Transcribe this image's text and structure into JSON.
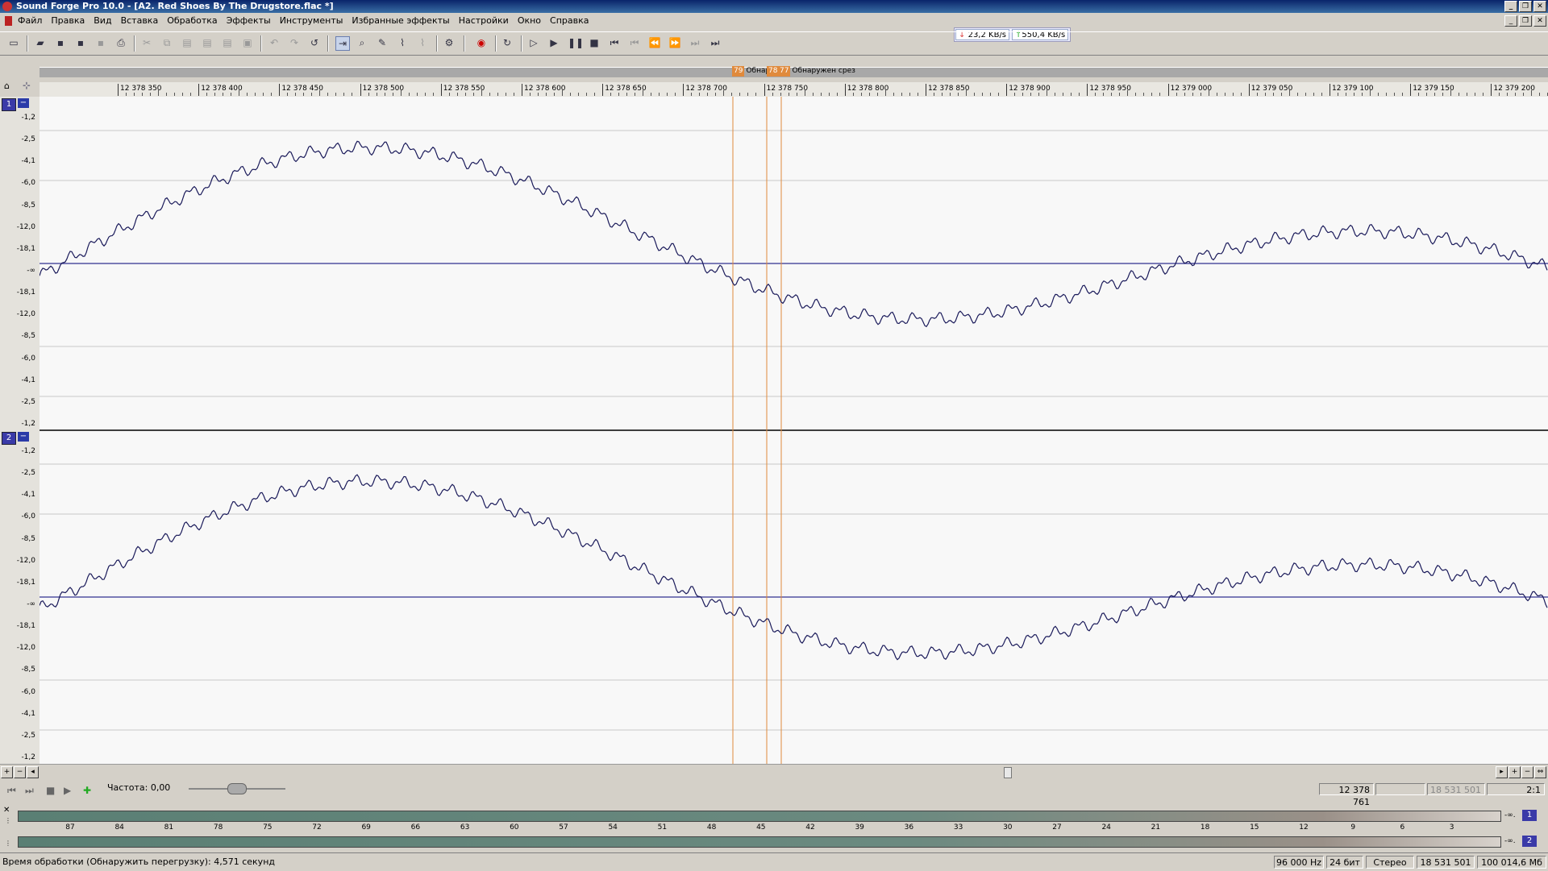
{
  "window": {
    "title": "Sound Forge Pro 10.0 - [A2. Red Shoes By The Drugstore.flac *]"
  },
  "menu": [
    "Файл",
    "Правка",
    "Вид",
    "Вставка",
    "Обработка",
    "Эффекты",
    "Инструменты",
    "Избранные эффекты",
    "Настройки",
    "Окно",
    "Справка"
  ],
  "network": {
    "download": "23,2 KB/s",
    "upload": "550,4 KB/s"
  },
  "markers": [
    {
      "flag": "79",
      "label": "Обнар"
    },
    {
      "flag": "78",
      "label": ""
    },
    {
      "flag": "77",
      "label": "Обнаружен срез"
    }
  ],
  "ruler_ticks": [
    "12 378 350",
    "12 378 400",
    "12 378 450",
    "12 378 500",
    "12 378 550",
    "12 378 600",
    "12 378 650",
    "12 378 700",
    "12 378 750",
    "12 378 800",
    "12 378 850",
    "12 378 900",
    "12 378 950",
    "12 379 000",
    "12 379 050",
    "12 379 100",
    "12 379 150",
    "12 379 200"
  ],
  "channels": [
    {
      "number": "1",
      "minimize": "−",
      "db_labels": [
        "-1,2",
        "-2,5",
        "-4,1",
        "-6,0",
        "-8,5",
        "-12,0",
        "-18,1",
        "-∞",
        "-18,1",
        "-12,0",
        "-8,5",
        "-6,0",
        "-4,1",
        "-2,5",
        "-1,2"
      ]
    },
    {
      "number": "2",
      "minimize": "−",
      "db_labels": [
        "-1,2",
        "-2,5",
        "-4,1",
        "-6,0",
        "-8,5",
        "-12,0",
        "-18,1",
        "-∞",
        "-18,1",
        "-12,0",
        "-8,5",
        "-6,0",
        "-4,1",
        "-2,5",
        "-1,2"
      ]
    }
  ],
  "transport": {
    "frequency_label": "Частота: 0,00",
    "position": "12 378 761",
    "selection_end": "",
    "length": "18 531 501",
    "zoom": "2:1"
  },
  "meter": {
    "scale": [
      "87",
      "84",
      "81",
      "78",
      "75",
      "72",
      "69",
      "66",
      "63",
      "60",
      "57",
      "54",
      "51",
      "48",
      "45",
      "42",
      "39",
      "36",
      "33",
      "30",
      "27",
      "24",
      "21",
      "18",
      "15",
      "12",
      "9",
      "6",
      "3"
    ],
    "inf": "-∞.",
    "channels": [
      "1",
      "2"
    ]
  },
  "status": {
    "message": "Время обработки (Обнаружить перегрузку): 4,571 секунд",
    "sample_rate": "96 000 Hz",
    "bit_depth": "24 бит",
    "channels": "Стерео",
    "length": "18 531 501",
    "size": "100 014,6 Мб"
  }
}
